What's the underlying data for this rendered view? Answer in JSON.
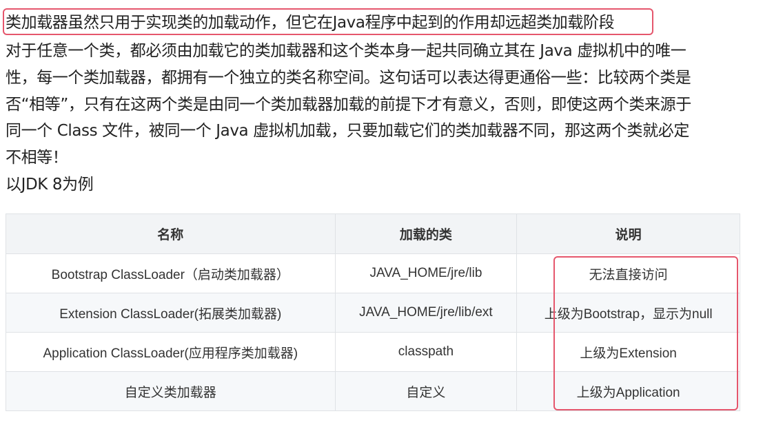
{
  "heading": "类加载器虽然只用于实现类的加载动作，但它在Java程序中起到的作用却远超类加载阶段",
  "paragraph_lines": [
    "对于任意一个类，都必须由加载它的类加载器和这个类本身一起共同确立其在 Java 虚拟机中的唯一",
    "性，每一个类加载器，都拥有一个独立的类名称空间。这句话可以表达得更通俗一些：比较两个类是",
    "否“相等”，只有在这两个类是由同一个类加载器加载的前提下才有意义，否则，即使这两个类来源于",
    "同一个 Class 文件，被同一个 Java 虚拟机加载，只要加载它们的类加载器不同，那这两个类就必定",
    "不相等！"
  ],
  "example_line": "以JDK 8为例",
  "table": {
    "headers": [
      "名称",
      "加载的类",
      "说明"
    ],
    "rows": [
      [
        "Bootstrap ClassLoader（启动类加载器）",
        "JAVA_HOME/jre/lib",
        "无法直接访问"
      ],
      [
        "Extension ClassLoader(拓展类加载器)",
        "JAVA_HOME/jre/lib/ext",
        "上级为Bootstrap，显示为null"
      ],
      [
        "Application ClassLoader(应用程序类加载器)",
        "classpath",
        "上级为Extension"
      ],
      [
        "自定义类加载器",
        "自定义",
        "上级为Application"
      ]
    ]
  },
  "colors": {
    "highlight_border": "#e5566c",
    "table_header_bg": "#f2f4f6",
    "table_stripe_bg": "#f6f8fa",
    "table_border": "#dfe2e5"
  }
}
